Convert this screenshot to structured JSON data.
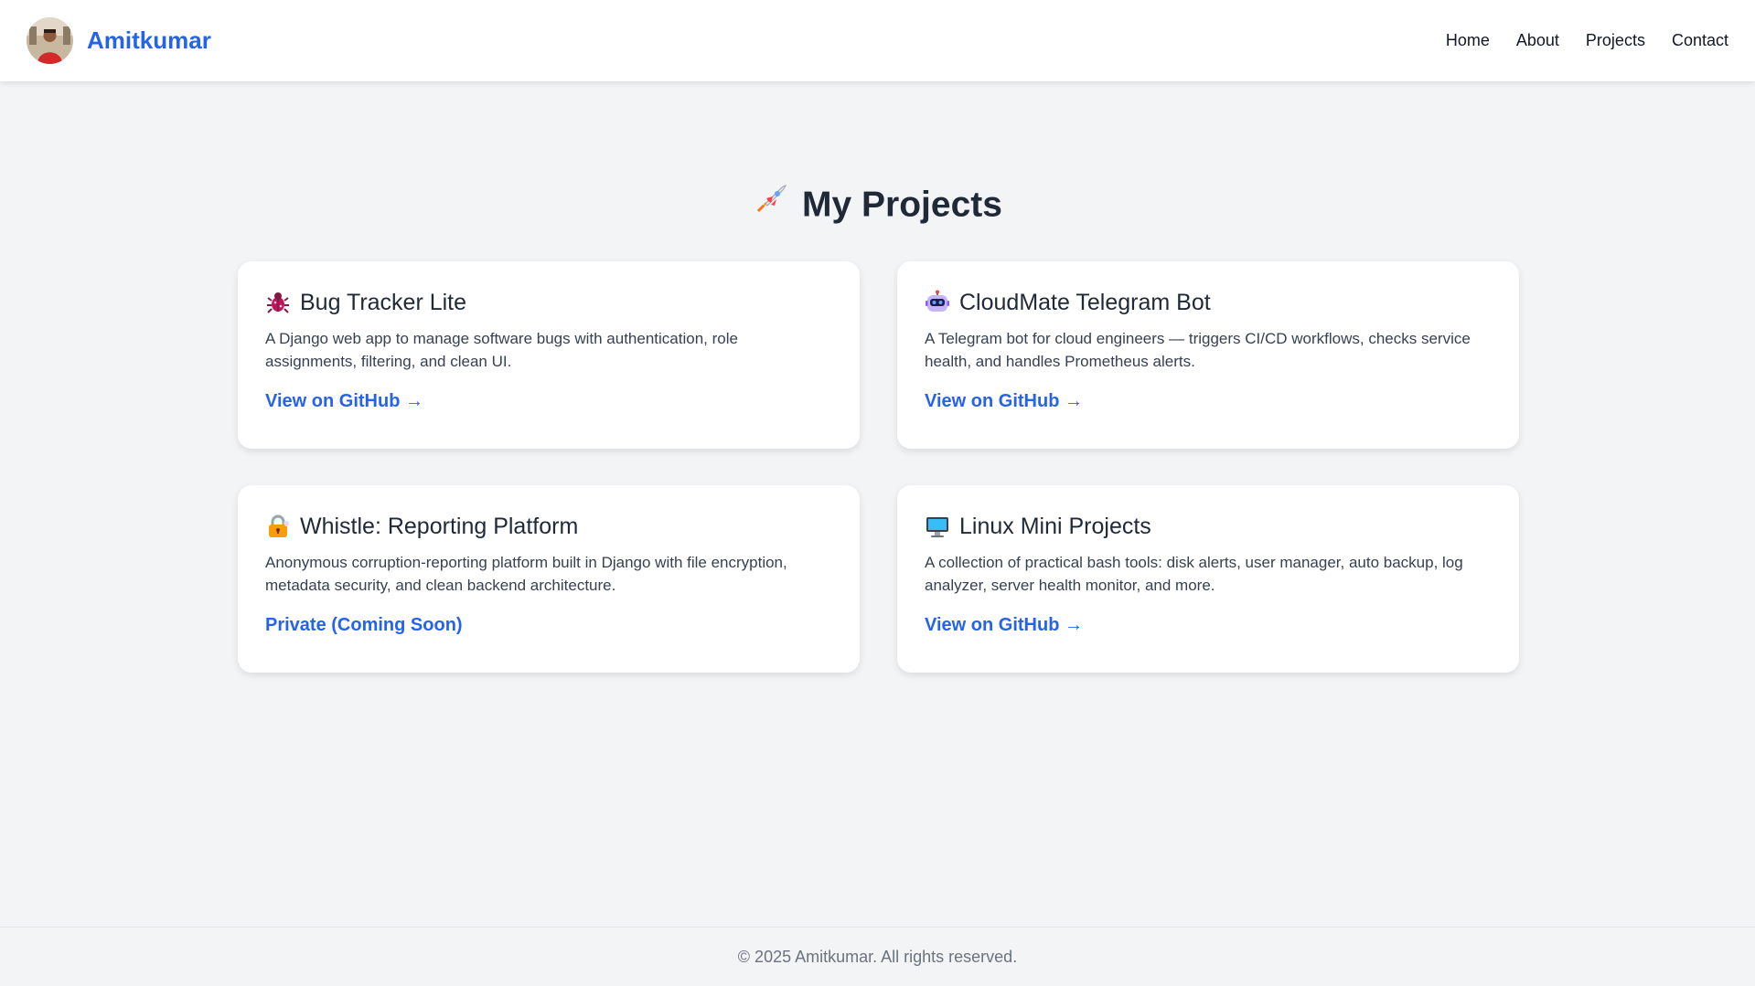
{
  "header": {
    "brand_name": "Amitkumar",
    "nav": [
      "Home",
      "About",
      "Projects",
      "Contact"
    ]
  },
  "page": {
    "title": "My Projects",
    "title_icon": "rocket-icon"
  },
  "projects": [
    {
      "icon": "bug-icon",
      "title": "Bug Tracker Lite",
      "description": "A Django web app to manage software bugs with authentication, role assignments, filtering, and clean UI.",
      "link": "View on GitHub →"
    },
    {
      "icon": "robot-icon",
      "title": "CloudMate Telegram Bot",
      "description": "A Telegram bot for cloud engineers — triggers CI/CD workflows, checks service health, and handles Prometheus alerts.",
      "link": "View on GitHub →"
    },
    {
      "icon": "lock-icon",
      "title": "Whistle: Reporting Platform",
      "description": "Anonymous corruption-reporting platform built in Django with file encryption, metadata security, and clean backend architecture.",
      "link": "Private (Coming Soon)"
    },
    {
      "icon": "desktop-computer-icon",
      "title": "Linux Mini Projects",
      "description": "A collection of practical bash tools: disk alerts, user manager, auto backup, log analyzer, server health monitor, and more.",
      "link": "View on GitHub →"
    }
  ],
  "footer": {
    "text": "© 2025 Amitkumar. All rights reserved."
  },
  "colors": {
    "accent": "#2563eb",
    "background": "#f3f4f6",
    "card": "#ffffff",
    "text": "#1f2937",
    "muted": "#6b7280"
  }
}
